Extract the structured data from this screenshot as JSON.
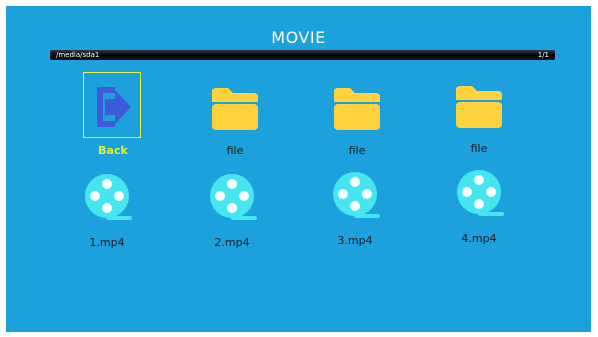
{
  "header": {
    "title": "MOVIE"
  },
  "path_bar": {
    "path": "/media/sda1",
    "page": "1/1"
  },
  "grid": {
    "row1": [
      {
        "label": "Back",
        "icon": "back-exit-icon",
        "selected": true
      },
      {
        "label": "file",
        "icon": "folder-icon"
      },
      {
        "label": "file",
        "icon": "folder-icon"
      },
      {
        "label": "file",
        "icon": "folder-icon"
      }
    ],
    "row2": [
      {
        "label": "1.mp4",
        "icon": "film-reel-icon"
      },
      {
        "label": "2.mp4",
        "icon": "film-reel-icon"
      },
      {
        "label": "3.mp4",
        "icon": "film-reel-icon"
      },
      {
        "label": "4.mp4",
        "icon": "film-reel-icon"
      }
    ]
  },
  "colors": {
    "background": "#1da1dc",
    "folder": "#ffd23c",
    "reel": "#46e6f0",
    "back_icon": "#3d5bd6",
    "selection": "#e8f23a"
  }
}
